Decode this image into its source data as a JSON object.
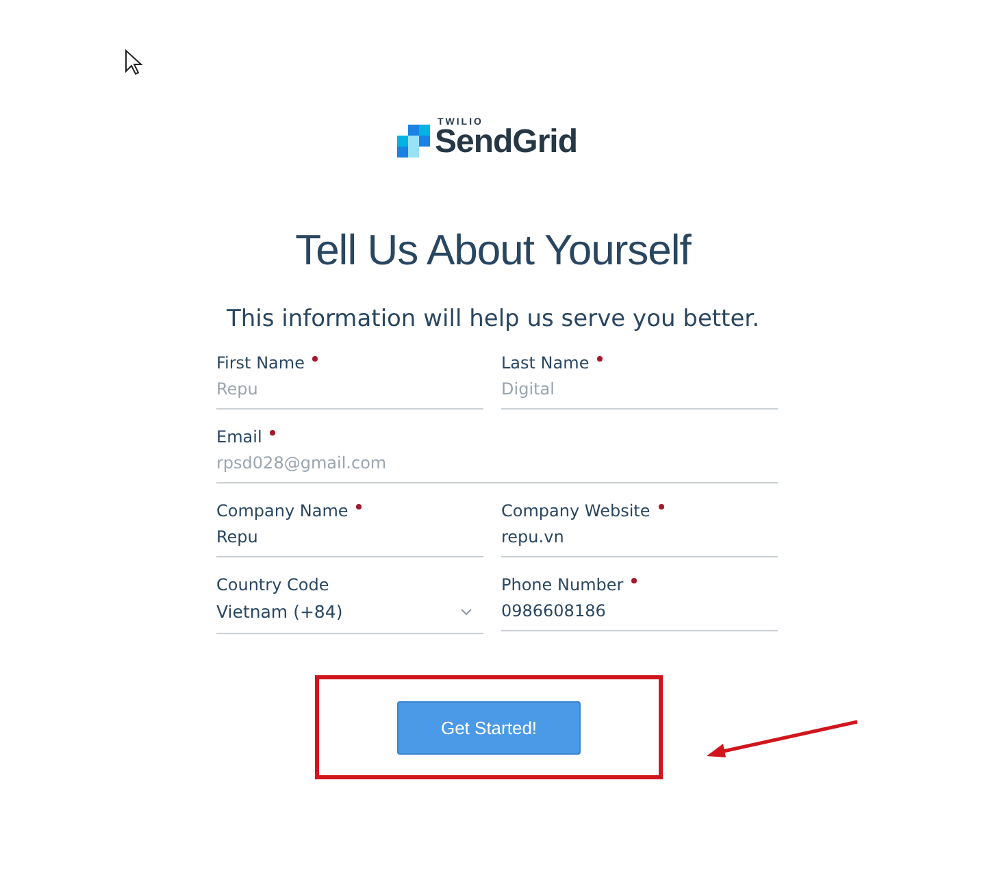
{
  "logo": {
    "overline": "TWILIO",
    "name": "SendGrid"
  },
  "title": "Tell Us About Yourself",
  "subtitle": "This information will help us serve you better.",
  "fields": [
    {
      "kind": "text",
      "label": "First Name",
      "required": true,
      "placeholder": "Repu"
    },
    {
      "kind": "text",
      "label": "Last Name",
      "required": true,
      "placeholder": "Digital"
    },
    {
      "kind": "text",
      "label": "Email",
      "required": true,
      "placeholder": "rpsd028@gmail.com",
      "wide": true
    },
    {
      "kind": "text",
      "label": "Company Name",
      "required": true,
      "value": "Repu"
    },
    {
      "kind": "text",
      "label": "Company Website",
      "required": true,
      "value": "repu.vn"
    },
    {
      "kind": "select",
      "label": "Country Code",
      "required": false,
      "value": "Vietnam (+84)"
    },
    {
      "kind": "text",
      "label": "Phone Number",
      "required": true,
      "value": "0986608186"
    }
  ],
  "submit": "Get Started!",
  "annotation": {
    "highlight": true
  }
}
